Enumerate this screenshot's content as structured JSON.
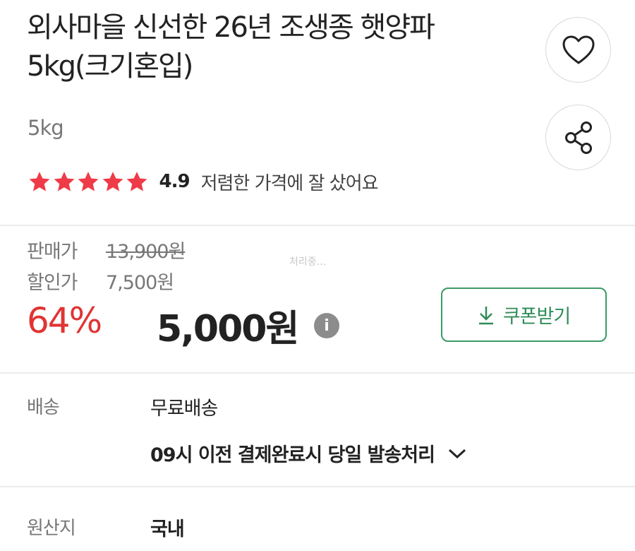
{
  "product": {
    "title_line1": "외사마을 신선한 26년 조생종 햇양파",
    "title_line2": "5kg(크기혼입)",
    "weight": "5kg"
  },
  "actions": {
    "wish_icon": "heart-icon",
    "share_icon": "share-icon"
  },
  "rating": {
    "stars": 5,
    "score": "4.9",
    "review": "저렴한 가격에 잘 샀어요"
  },
  "price": {
    "sale_label": "판매가",
    "original": "13,900원",
    "discount_label": "할인가",
    "discount_price": "7,500원",
    "processing": "처리중...",
    "rate": "64%",
    "final": "5,000원",
    "info": "i",
    "coupon_label": "쿠폰받기"
  },
  "shipping": {
    "label": "배송",
    "value": "무료배송",
    "dispatch": "09시 이전 결제완료시 당일 발송처리"
  },
  "origin": {
    "label": "원산지",
    "value": "국내"
  },
  "colors": {
    "accent_red": "#e03434",
    "star": "#ef3a47",
    "coupon_green": "#2e8c57"
  }
}
